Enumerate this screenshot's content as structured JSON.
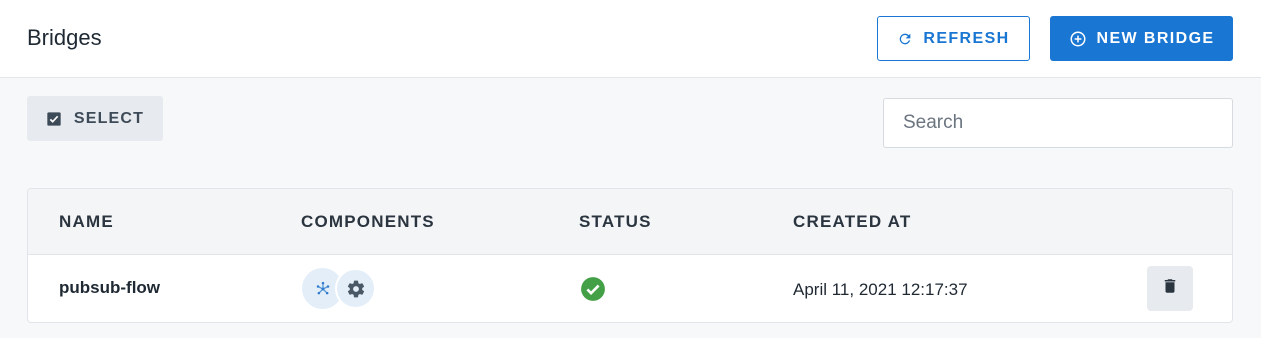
{
  "header": {
    "title": "Bridges",
    "refresh_label": "REFRESH",
    "new_bridge_label": "NEW BRIDGE"
  },
  "toolbar": {
    "select_label": "SELECT",
    "search_placeholder": "Search"
  },
  "table": {
    "columns": [
      "NAME",
      "COMPONENTS",
      "STATUS",
      "CREATED AT"
    ],
    "rows": [
      {
        "name": "pubsub-flow",
        "components": [
          "cluster-icon",
          "gear-icon"
        ],
        "status": "success-check-icon",
        "created_at": "April 11, 2021 12:17:37"
      }
    ]
  },
  "colors": {
    "primary": "#1976d2",
    "success": "#43a047",
    "component_bg": "#e3eef9"
  }
}
